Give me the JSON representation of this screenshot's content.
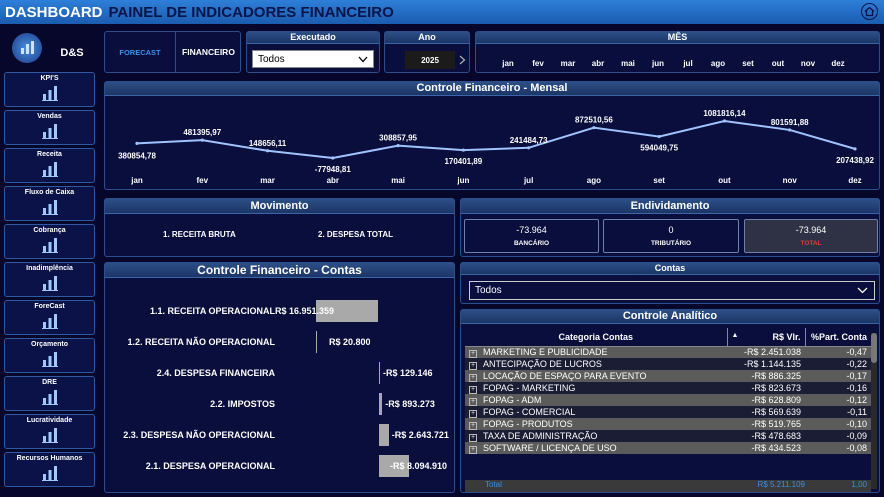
{
  "header": {
    "title_bold": "DASHBOARD",
    "title_rest": "PAINEL DE INDICADORES FINANCEIRO"
  },
  "logo": {
    "brand": "D&S"
  },
  "sidebar": [
    {
      "label": "KPI'S",
      "icon": "kpi-icon"
    },
    {
      "label": "Vendas",
      "icon": "sales-icon"
    },
    {
      "label": "Receita",
      "icon": "revenue-icon"
    },
    {
      "label": "Fluxo de Caixa",
      "icon": "cash-flow-icon"
    },
    {
      "label": "Cobrança",
      "icon": "billing-icon"
    },
    {
      "label": "Inadimplência",
      "icon": "default-icon"
    },
    {
      "label": "ForeCast",
      "icon": "forecast-icon"
    },
    {
      "label": "Orçamento",
      "icon": "budget-icon"
    },
    {
      "label": "DRE",
      "icon": "dre-icon"
    },
    {
      "label": "Lucratividade",
      "icon": "profit-icon"
    },
    {
      "label": "Recursos Humanos",
      "icon": "hr-icon"
    }
  ],
  "nav": {
    "forecast": "FORECAST",
    "financeiro": "FINANCEIRO"
  },
  "filters": {
    "executado_title": "Executado",
    "executado_value": "Todos",
    "ano_title": "Ano",
    "ano_value": "2025",
    "mes_title": "MÊS",
    "months": [
      "jan",
      "fev",
      "mar",
      "abr",
      "mai",
      "jun",
      "jul",
      "ago",
      "set",
      "out",
      "nov",
      "dez"
    ]
  },
  "monthly": {
    "title": "Controle Financeiro - Mensal",
    "chart_data": {
      "type": "line",
      "categories": [
        "jan",
        "fev",
        "mar",
        "abr",
        "mai",
        "jun",
        "jul",
        "ago",
        "set",
        "out",
        "nov",
        "dez"
      ],
      "values": [
        380854.78,
        481395.97,
        148656.11,
        -77948.81,
        308857.95,
        170401.89,
        241484.73,
        872510.56,
        594049.75,
        1081816.14,
        801591.88,
        207438.92
      ],
      "labels": [
        "380854,78",
        "481395,97",
        "148656,11",
        "-77948,81",
        "308857,95",
        "170401,89",
        "241484,73",
        "872510,56",
        "594049,75",
        "1081816,14",
        "801591,88",
        "207438,92"
      ]
    }
  },
  "movimento": {
    "title": "Movimento",
    "item1": "1. RECEITA BRUTA",
    "item2": "2. DESPESA TOTAL"
  },
  "endividamento": {
    "title": "Endividamento",
    "cards": [
      {
        "value": "-73.964",
        "label": "BANCÁRIO"
      },
      {
        "value": "0",
        "label": "TRIBUTÁRIO"
      },
      {
        "value": "-73.964",
        "label": "TOTAL"
      }
    ]
  },
  "contas_chart": {
    "title": "Controle Financeiro - Contas",
    "chart_data": {
      "type": "bar",
      "categories": [
        "1.1. RECEITA OPERACIONAL",
        "1.2. RECEITA NÃO OPERACIONAL",
        "2.4. DESPESA FINANCEIRA",
        "2.2. IMPOSTOS",
        "2.3. DESPESA NÃO OPERACIONAL",
        "2.1. DESPESA OPERACIONAL"
      ],
      "values": [
        16951359,
        20800,
        -129146,
        -893273,
        -2643721,
        -8094910
      ],
      "labels": [
        "R$ 16.951.359",
        "R$ 20.800",
        "-R$ 129.146",
        "-R$ 893.273",
        "-R$ 2.643.721",
        "-R$ 8.094.910"
      ]
    }
  },
  "contas_filter": {
    "title": "Contas",
    "value": "Todos"
  },
  "analitico": {
    "title": "Controle Analítico",
    "columns": [
      "Categoria Contas",
      "R$ Vlr.",
      "%Part. Conta"
    ],
    "rows": [
      [
        "MARKETING E PUBLICIDADE",
        "-R$ 2.451.038",
        "-0,47"
      ],
      [
        "ANTECIPAÇÃO DE LUCROS",
        "-R$ 1.144.135",
        "-0,22"
      ],
      [
        "LOCAÇÃO DE ESPAÇO PARA EVENTO",
        "-R$ 886.325",
        "-0,17"
      ],
      [
        "FOPAG - MARKETING",
        "-R$ 823.673",
        "-0,16"
      ],
      [
        "FOPAG - ADM",
        "-R$ 628.809",
        "-0,12"
      ],
      [
        "FOPAG - COMERCIAL",
        "-R$ 569.639",
        "-0,11"
      ],
      [
        "FOPAG - PRODUTOS",
        "-R$ 519.765",
        "-0,10"
      ],
      [
        "TAXA DE ADMINISTRAÇÃO",
        "-R$ 478.683",
        "-0,09"
      ],
      [
        "SOFTWARE / LICENÇA DE USO",
        "-R$ 434.523",
        "-0,08"
      ]
    ],
    "total": [
      "Total",
      "R$ 5.211.109",
      "1,00"
    ]
  }
}
